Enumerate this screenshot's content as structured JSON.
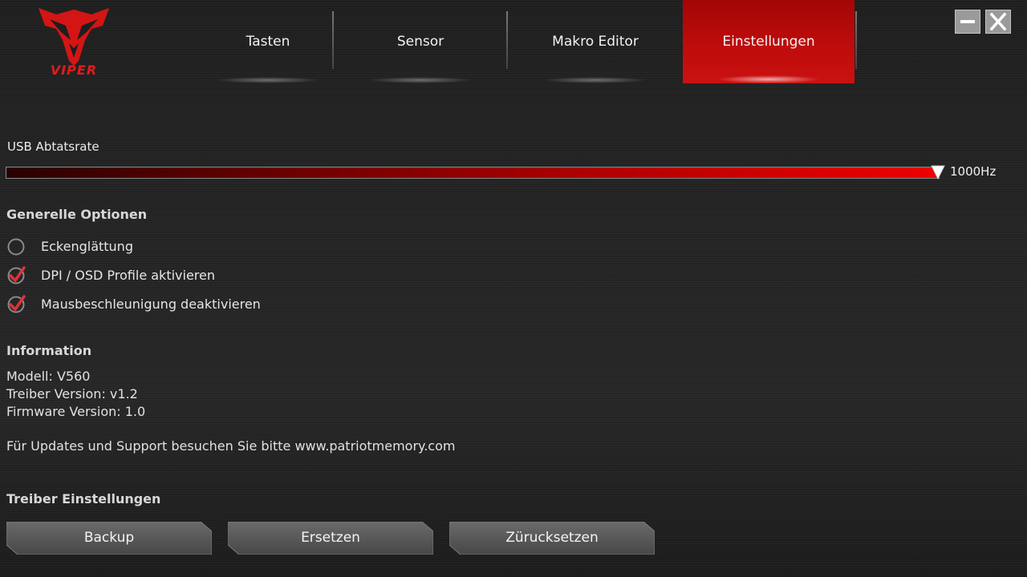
{
  "brand": {
    "logo_text": "VIPER",
    "color": "#e31b1b"
  },
  "tabs": [
    {
      "label": "Tasten",
      "active": false
    },
    {
      "label": "Sensor",
      "active": false
    },
    {
      "label": "Makro Editor",
      "active": false
    },
    {
      "label": "Einstellungen",
      "active": true
    }
  ],
  "window_controls": {
    "minimize_icon": "minimize-icon",
    "close_icon": "close-icon"
  },
  "usb": {
    "label": "USB Abtatsrate",
    "value": "1000Hz",
    "level": 1.0
  },
  "general": {
    "title": "Generelle Optionen",
    "options": [
      {
        "label": "Eckenglättung",
        "checked": false
      },
      {
        "label": "DPI / OSD Profile aktivieren",
        "checked": true
      },
      {
        "label": "Mausbeschleunigung deaktivieren",
        "checked": true
      }
    ]
  },
  "information": {
    "title": "Information",
    "model": "Modell: V560",
    "driver": "Treiber Version: v1.2",
    "firmware": "Firmware Version: 1.0",
    "support": "Für Updates und Support besuchen Sie bitte www.patriotmemory.com"
  },
  "driver_settings": {
    "title": "Treiber Einstellungen",
    "buttons": [
      {
        "label": "Backup"
      },
      {
        "label": "Ersetzen"
      },
      {
        "label": "Zürucksetzen"
      }
    ]
  },
  "colors": {
    "accent": "#c10c0c",
    "active_tab": "#b00909",
    "checkmark": "#e0323a"
  }
}
